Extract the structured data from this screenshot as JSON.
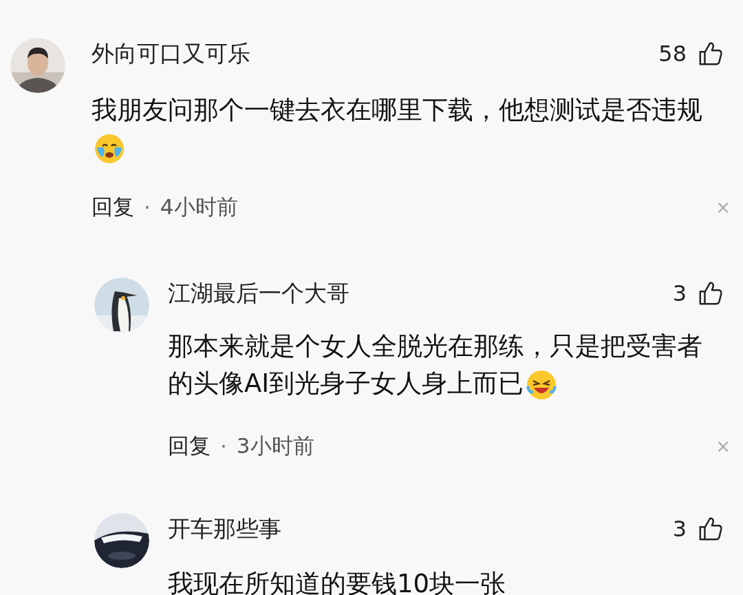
{
  "comments": [
    {
      "avatar": {
        "kind": "person"
      },
      "name": "外向可口又可乐",
      "likes": "58",
      "text": "我朋友问那个一键去衣在哪里下载，他想测试是否违规",
      "emoji": {
        "kind": "crying"
      },
      "reply_label": "回复",
      "dot": "·",
      "time": "4小时前",
      "close": "×",
      "children": [
        {
          "avatar": {
            "kind": "penguin"
          },
          "name": "江湖最后一个大哥",
          "likes": "3",
          "text": "那本来就是个女人全脱光在那练，只是把受害者的头像AI到光身子女人身上而已",
          "emoji": {
            "kind": "laughing"
          },
          "reply_label": "回复",
          "dot": "·",
          "time": "3小时前",
          "close": "×"
        },
        {
          "avatar": {
            "kind": "car"
          },
          "name": "开车那些事",
          "likes": "3",
          "text": "我现在所知道的要钱10块一张"
        }
      ]
    }
  ]
}
